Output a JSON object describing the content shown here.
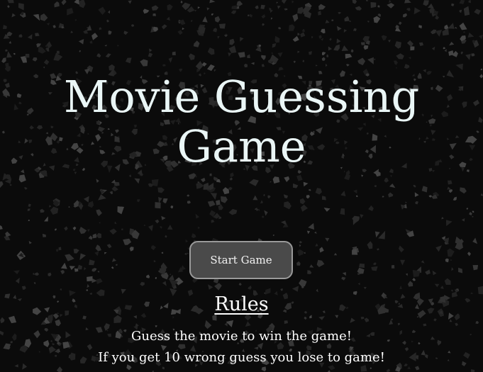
{
  "page": {
    "title": "Movie Guessing Game"
  },
  "start_button": {
    "label": "Start Game"
  },
  "rules": {
    "heading": "Rules",
    "lines": [
      "Guess the movie to win the game!",
      "If you get 10 wrong guess you lose to game!"
    ]
  },
  "colors": {
    "background": "#0b0b0b",
    "title_text": "#eaf6f6",
    "button_fill": "#4a4a4a",
    "button_border": "#9a9a9a"
  }
}
